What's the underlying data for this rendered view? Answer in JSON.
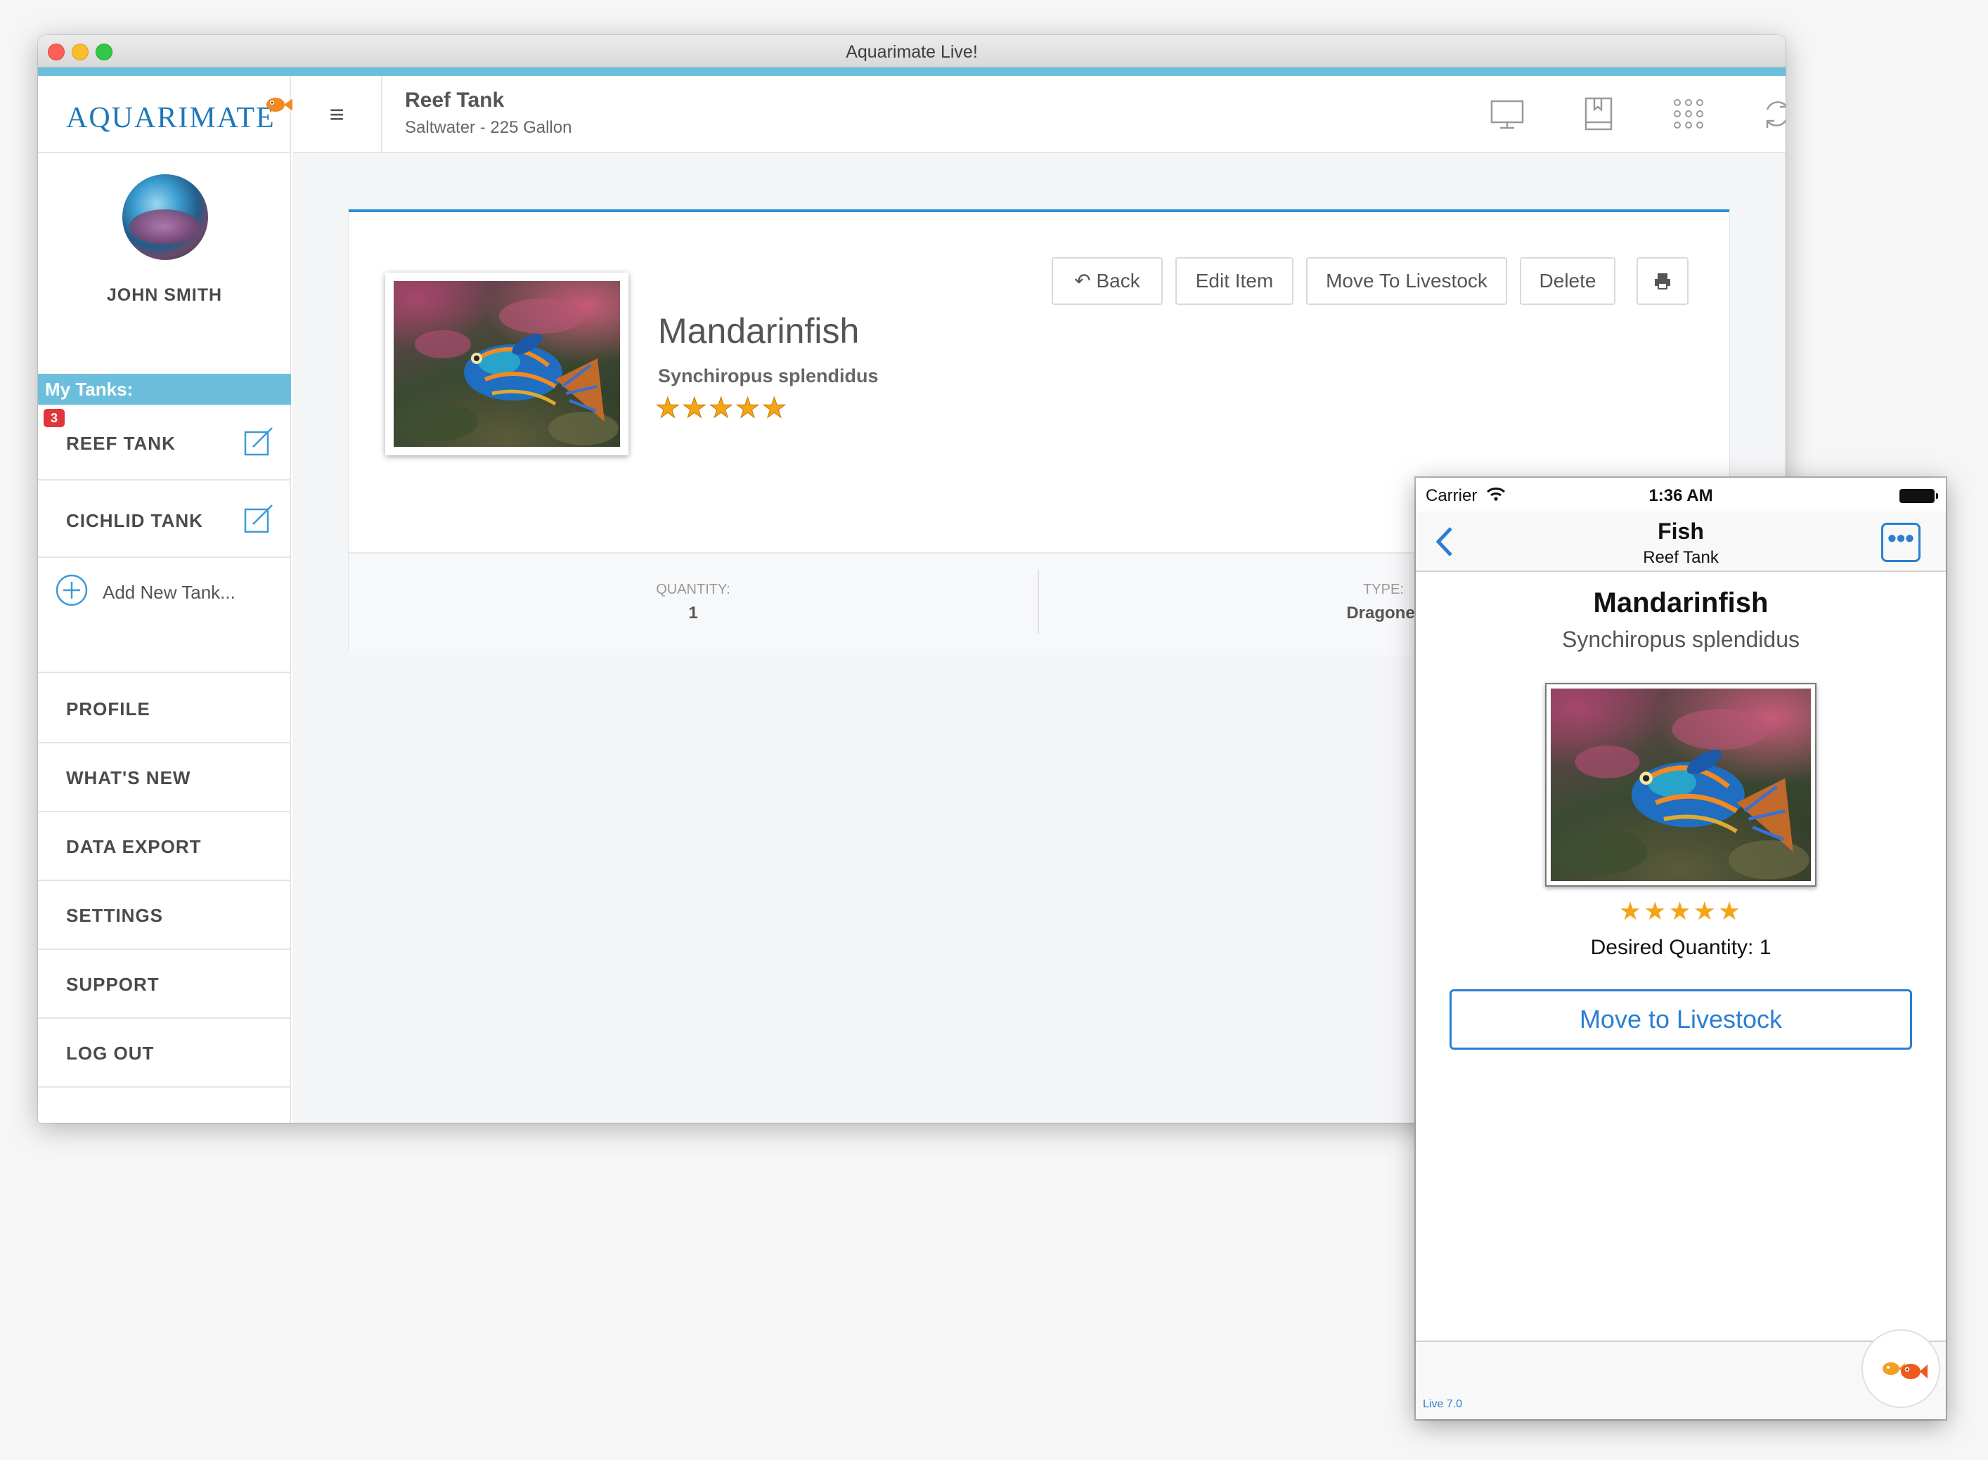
{
  "window": {
    "title": "Aquarimate Live!"
  },
  "sidebar": {
    "logo_text": "AQUARIMATE",
    "username": "JOHN SMITH",
    "my_tanks_label": "My Tanks:",
    "tanks": [
      {
        "label": "REEF TANK",
        "badge": "3"
      },
      {
        "label": "CICHLID TANK",
        "badge": ""
      }
    ],
    "add_tank_label": "Add New Tank...",
    "nav": [
      {
        "label": "PROFILE"
      },
      {
        "label": "WHAT'S NEW"
      },
      {
        "label": "DATA EXPORT"
      },
      {
        "label": "SETTINGS"
      },
      {
        "label": "SUPPORT"
      },
      {
        "label": "LOG OUT"
      }
    ]
  },
  "header": {
    "tank_title": "Reef Tank",
    "tank_subtitle": "Saltwater - 225 Gallon",
    "icons": [
      "monitor-icon",
      "book-icon",
      "grid-icon",
      "refresh-icon"
    ]
  },
  "detail": {
    "name": "Mandarinfish",
    "scientific_name": "Synchiropus splendidus",
    "rating": "★★★★★",
    "rating_value": 5,
    "buttons": {
      "back": "Back",
      "edit": "Edit Item",
      "move": "Move To Livestock",
      "delete": "Delete"
    },
    "stats": [
      {
        "label": "QUANTITY:",
        "value": "1"
      },
      {
        "label": "TYPE:",
        "value": "Dragonet"
      }
    ]
  },
  "phone": {
    "carrier": "Carrier",
    "time": "1:36 AM",
    "nav_title": "Fish",
    "nav_subtitle": "Reef Tank",
    "name": "Mandarinfish",
    "scientific_name": "Synchiropus splendidus",
    "rating": "★★★★★",
    "rating_value": 5,
    "quantity_label": "Desired Quantity:",
    "quantity_value": "1",
    "move_button": "Move to Livestock",
    "version": "Live 7.0"
  },
  "colors": {
    "accent_blue": "#6cbedd",
    "link_blue": "#2a7fd2",
    "card_top_border": "#2d8fd5",
    "star": "#f6a417",
    "badge_red": "#e0363a",
    "logo_orange": "#f28a21"
  }
}
